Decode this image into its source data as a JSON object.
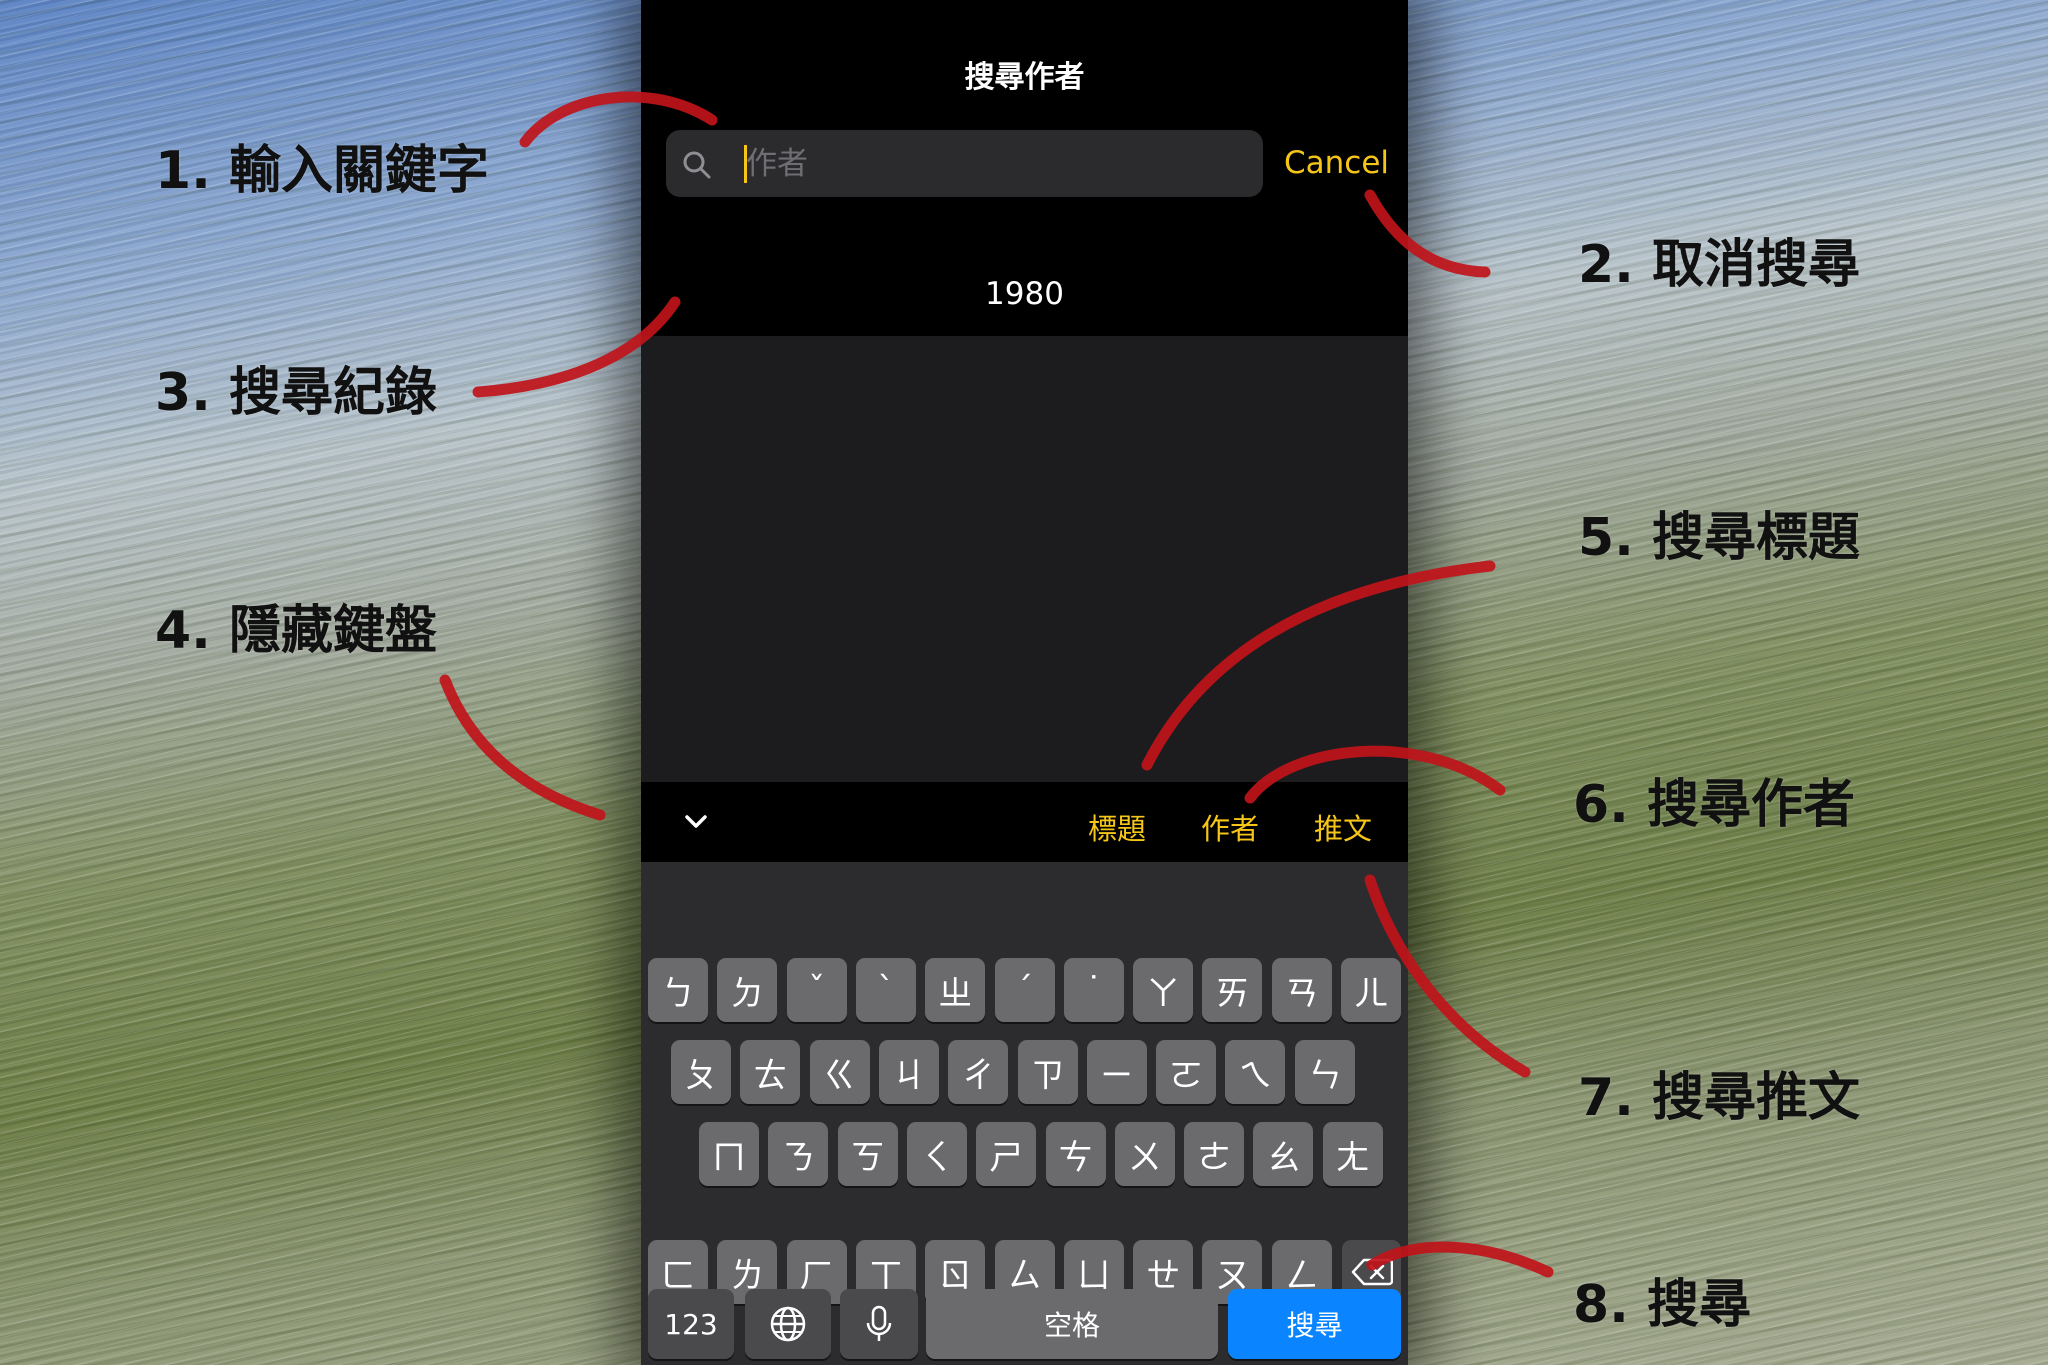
{
  "screen": {
    "title": "搜尋作者",
    "search": {
      "placeholder": "作者",
      "value": ""
    },
    "cancel_label": "Cancel",
    "history": [
      "1980"
    ]
  },
  "scope_bar": {
    "hide_keyboard_icon": "chevron-down-icon",
    "scopes": [
      "標題",
      "作者",
      "推文"
    ]
  },
  "keyboard": {
    "row1": [
      "ㄅ",
      "ㄉ",
      "ˇ",
      "ˋ",
      "ㄓ",
      "ˊ",
      "˙",
      "ㄚ",
      "ㄞ",
      "ㄢ",
      "ㄦ"
    ],
    "row2": [
      "ㄆ",
      "ㄊ",
      "ㄍ",
      "ㄐ",
      "ㄔ",
      "ㄗ",
      "ㄧ",
      "ㄛ",
      "ㄟ",
      "ㄣ"
    ],
    "row3": [
      "ㄇ",
      "ㄋ",
      "ㄎ",
      "ㄑ",
      "ㄕ",
      "ㄘ",
      "ㄨ",
      "ㄜ",
      "ㄠ",
      "ㄤ"
    ],
    "row4": [
      "ㄈ",
      "ㄌ",
      "ㄏ",
      "ㄒ",
      "ㄖ",
      "ㄙ",
      "ㄩ",
      "ㄝ",
      "ㄡ",
      "ㄥ"
    ],
    "numbers_label": "123",
    "space_label": "空格",
    "search_label": "搜尋",
    "icons": {
      "globe": "globe-icon",
      "mic": "microphone-icon",
      "delete": "delete-backspace-icon"
    }
  },
  "annotations": [
    {
      "num": "1.",
      "text": "輸入關鍵字"
    },
    {
      "num": "2.",
      "text": "取消搜尋"
    },
    {
      "num": "3.",
      "text": "搜尋紀錄"
    },
    {
      "num": "4.",
      "text": "隱藏鍵盤"
    },
    {
      "num": "5.",
      "text": "搜尋標題"
    },
    {
      "num": "6.",
      "text": "搜尋作者"
    },
    {
      "num": "7.",
      "text": "搜尋推文"
    },
    {
      "num": "8.",
      "text": "搜尋"
    }
  ],
  "colors": {
    "accent": "#f5c518",
    "arrow": "#c0141a",
    "search_key": "#0a84ff"
  }
}
